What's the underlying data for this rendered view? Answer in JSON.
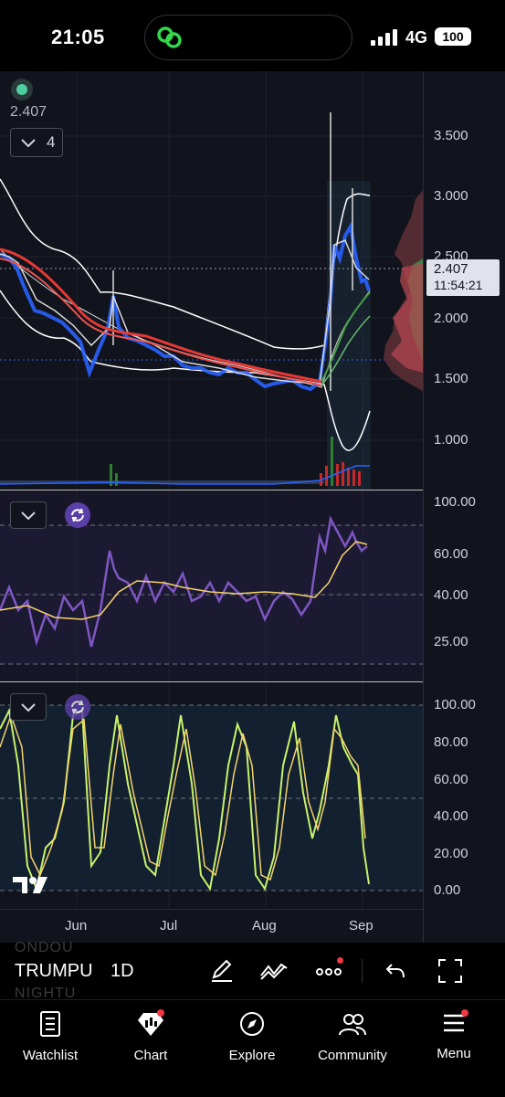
{
  "status_bar": {
    "time": "21:05",
    "network": "4G",
    "battery": "100"
  },
  "legend": {
    "price": "2.407",
    "collapse_count": "4"
  },
  "price_axis": {
    "main": [
      "3.500",
      "3.000",
      "2.500",
      "2.000",
      "1.500",
      "1.000"
    ],
    "current_price": "2.407",
    "countdown": "11:54:21",
    "rsi": [
      "100.00",
      "60.00",
      "40.00",
      "25.00"
    ],
    "stoch": [
      "100.00",
      "80.00",
      "60.00",
      "40.00",
      "20.00",
      "0.00"
    ]
  },
  "time_axis": [
    "Jun",
    "Jul",
    "Aug",
    "Sep"
  ],
  "toolbar": {
    "symbol": "TRUMPU",
    "symbol_ghost_above": "ONDOU",
    "symbol_ghost_below": "NIGHTU",
    "interval": "1D"
  },
  "bottom_nav": [
    {
      "label": "Watchlist",
      "icon": "watchlist-icon"
    },
    {
      "label": "Chart",
      "icon": "chart-icon"
    },
    {
      "label": "Explore",
      "icon": "compass-icon"
    },
    {
      "label": "Community",
      "icon": "community-icon"
    },
    {
      "label": "Menu",
      "icon": "menu-icon"
    }
  ],
  "colors": {
    "background": "#11141c",
    "rsi_line": "#7e57c2",
    "stoch_k": "#c7f26b",
    "stoch_d": "#f5d36b",
    "candle_up": "#d9d9d9",
    "candle_down": "#2962ff",
    "ma_red": "#e53935",
    "bollinger": "#ffffff",
    "alert": "#f23645"
  }
}
